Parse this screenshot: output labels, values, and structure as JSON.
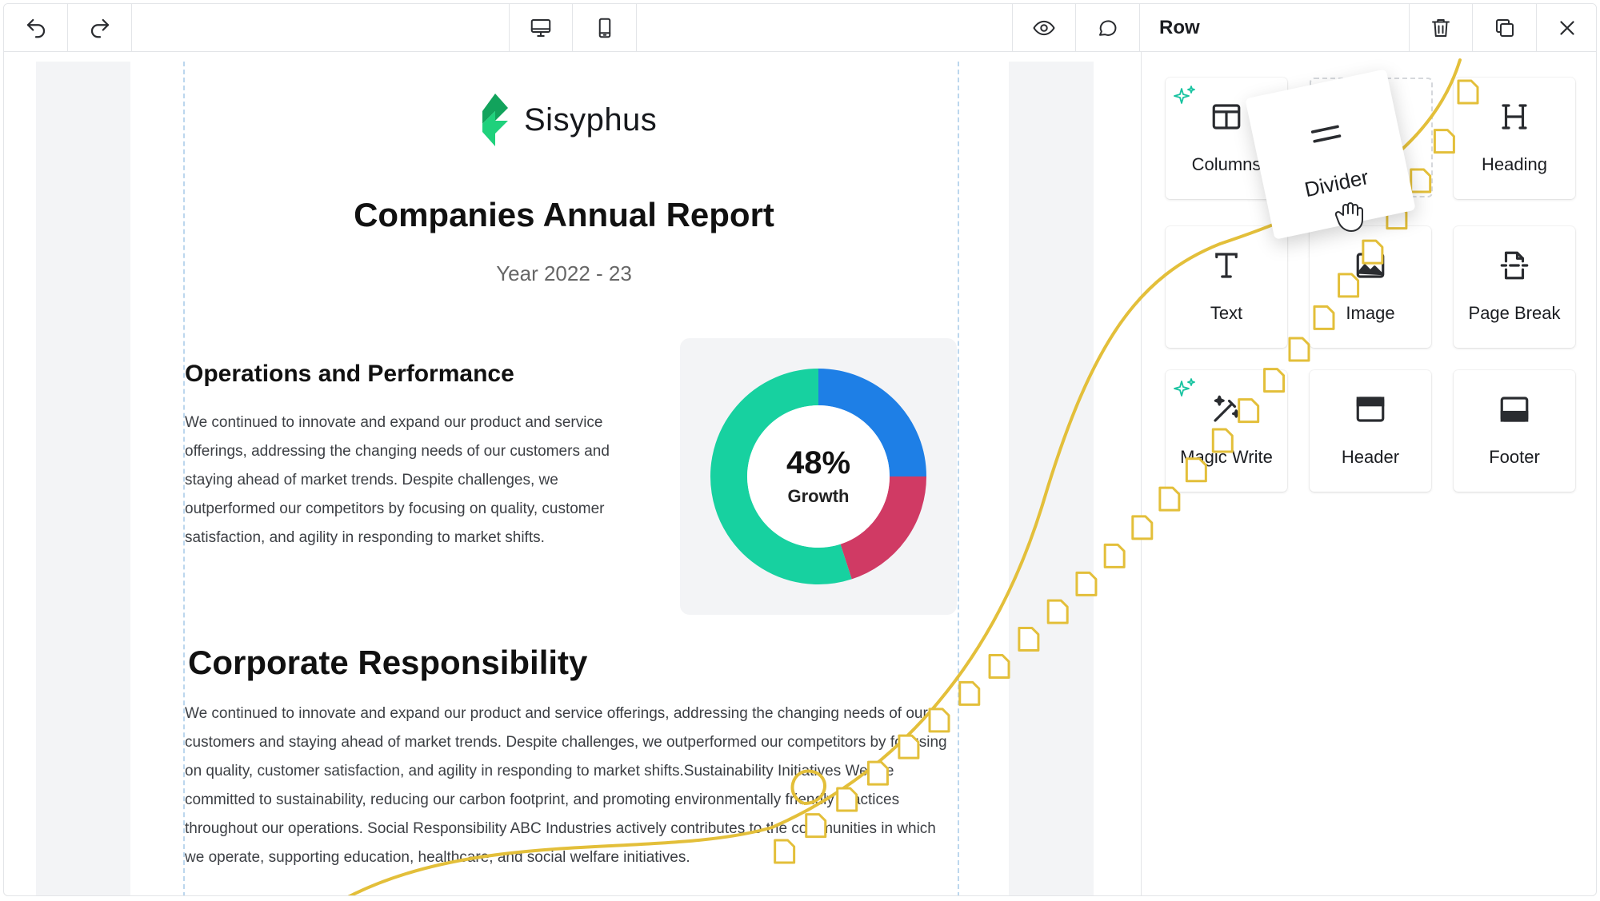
{
  "toolbar": {
    "undo_icon": "undo-icon",
    "redo_icon": "redo-icon",
    "desktop_icon": "desktop-icon",
    "mobile_icon": "mobile-icon",
    "preview_icon": "eye-icon",
    "comment_icon": "comment-icon"
  },
  "panel": {
    "title": "Row",
    "actions": [
      "trash-icon",
      "duplicate-icon",
      "close-icon"
    ],
    "blocks": [
      {
        "label": "Columns",
        "icon": "columns-icon",
        "ai": true
      },
      {
        "label": "Divider",
        "icon": "divider-icon",
        "dragging": true
      },
      {
        "label": "Heading",
        "icon": "heading-icon"
      },
      {
        "label": "Text",
        "icon": "text-icon"
      },
      {
        "label": "Image",
        "icon": "image-icon"
      },
      {
        "label": "Page Break",
        "icon": "page-break-icon"
      },
      {
        "label": "Magic Write",
        "icon": "magic-wand-icon",
        "ai": true
      },
      {
        "label": "Header",
        "icon": "header-icon"
      },
      {
        "label": "Footer",
        "icon": "footer-icon"
      }
    ]
  },
  "document": {
    "brand": "Sisyphus",
    "title": "Companies Annual Report",
    "subtitle": "Year 2022 - 23",
    "section1": {
      "heading": "Operations and Performance",
      "body": "We continued to innovate and expand our product and service offerings, addressing the changing needs of our customers and staying ahead of market trends. Despite challenges, we outperformed our competitors by focusing on quality, customer satisfaction, and agility in responding to market shifts."
    },
    "chart": {
      "value": "48%",
      "label": "Growth"
    },
    "section2": {
      "heading": "Corporate Responsibility",
      "body": "We continued to innovate and expand our product and service offerings, addressing the changing needs of our customers and staying ahead of market trends. Despite challenges, we outperformed our competitors by focusing on quality, customer satisfaction, and agility in responding to market shifts.Sustainability Initiatives We are committed to sustainability, reducing our carbon footprint, and promoting environmentally friendly practices throughout our operations. Social Responsibility ABC Industries actively contributes to the communities in which we operate, supporting education, healthcare, and social welfare initiatives."
    }
  },
  "chart_data": {
    "type": "pie",
    "categories": [
      "",
      "",
      ""
    ],
    "values": [
      0.25,
      0.2,
      0.55
    ],
    "colors": [
      "#1E7FE6",
      "#D03A64",
      "#17D1A0"
    ],
    "center_text": "48%",
    "center_label": "Growth"
  },
  "colors": {
    "accent_yellow": "#E3BF3A",
    "brand_green": "#1DB86B",
    "ai_sparkle": "#17C3A0",
    "guide_blue": "#BCD7EE"
  }
}
